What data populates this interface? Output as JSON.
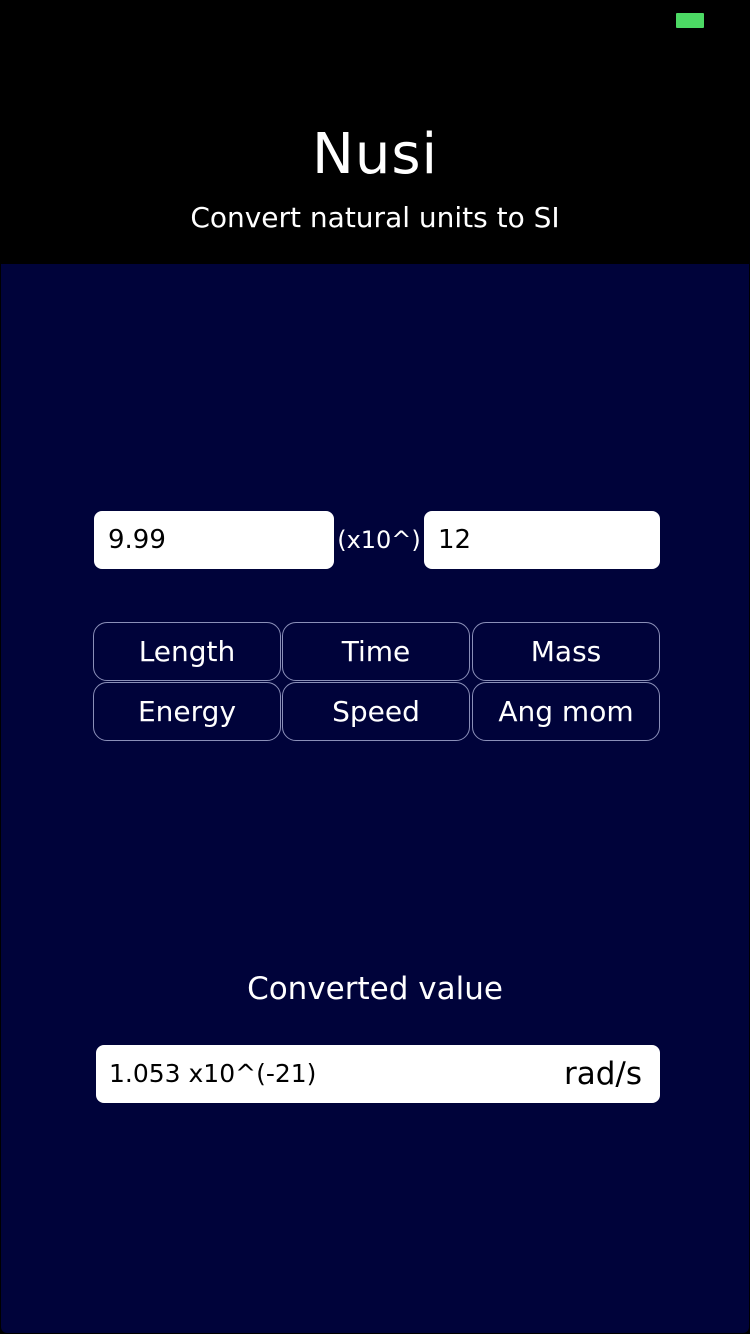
{
  "status_bar": {
    "battery_color": "#4cd964",
    "battery_icon": "battery-icon"
  },
  "header": {
    "title": "Nusi",
    "subtitle": "Convert natural units to SI"
  },
  "input": {
    "mantissa_value": "9.99",
    "multiplier_label": "(x10^)",
    "exponent_value": "12"
  },
  "unit_buttons": [
    {
      "label": "Length"
    },
    {
      "label": "Time"
    },
    {
      "label": "Mass"
    },
    {
      "label": "Energy"
    },
    {
      "label": "Speed"
    },
    {
      "label": "Ang mom"
    }
  ],
  "result": {
    "label": "Converted value",
    "value": "1.053 x10^(-21)",
    "unit": "rad/s"
  },
  "colors": {
    "header_background": "#000000",
    "main_background": "#00033a",
    "button_border": "#8a8fb8",
    "text_light": "#ffffff"
  }
}
